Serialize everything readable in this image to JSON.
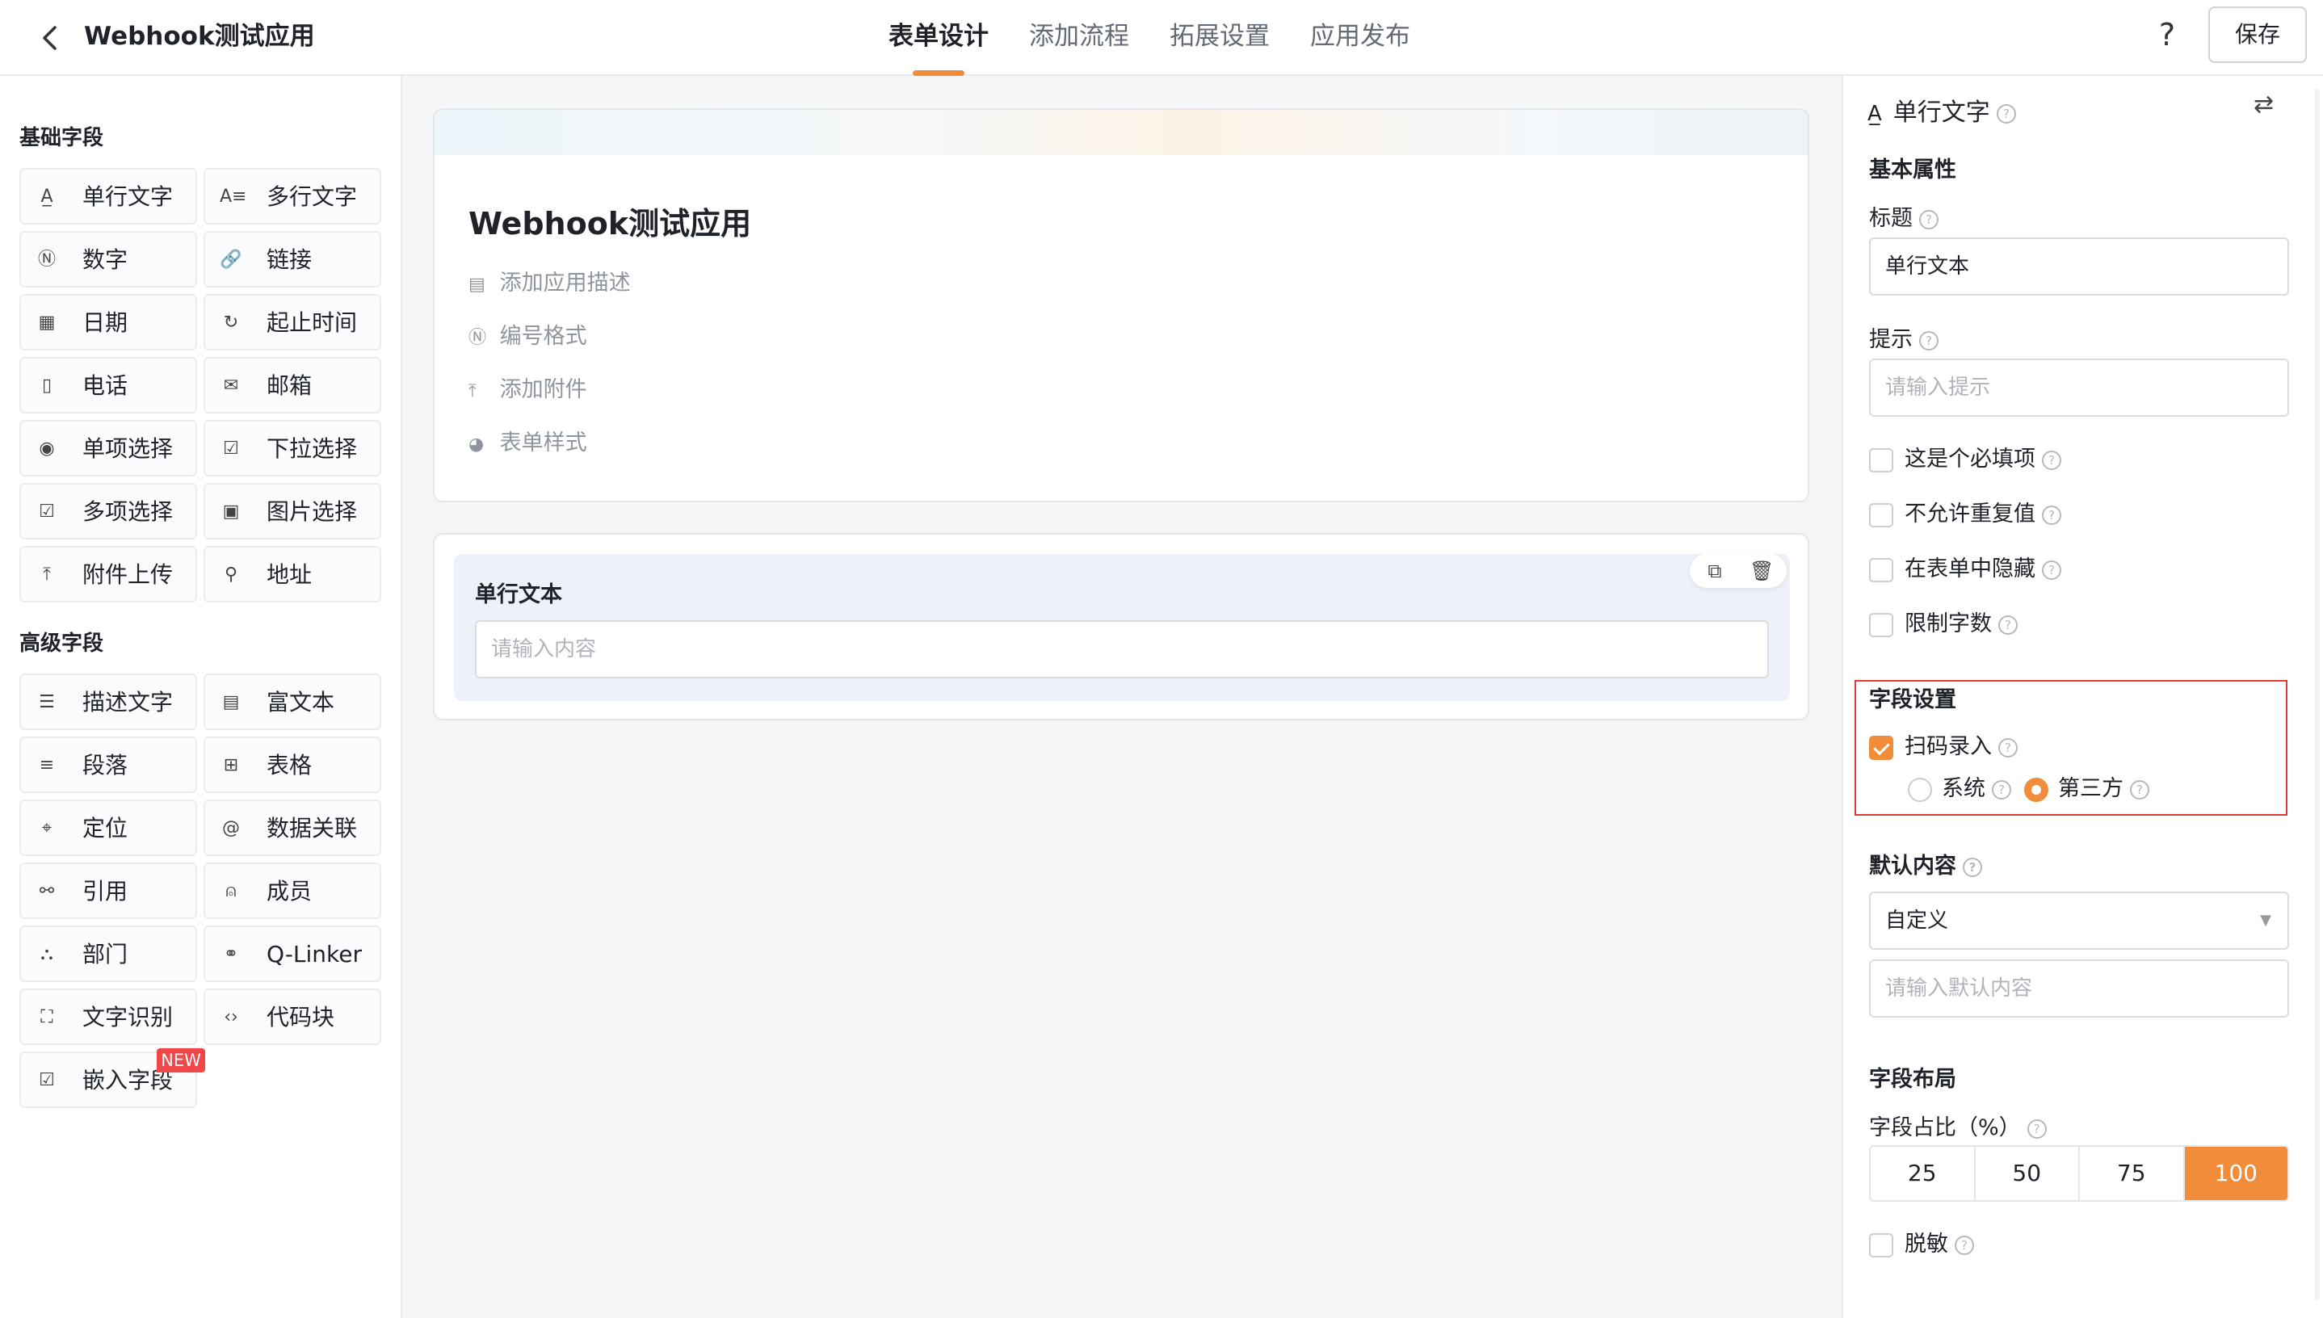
{
  "header": {
    "back_icon": "chevron-left-icon",
    "app_title": "Webhook测试应用",
    "tabs": [
      {
        "label": "表单设计",
        "active": true
      },
      {
        "label": "添加流程"
      },
      {
        "label": "拓展设置"
      },
      {
        "label": "应用发布"
      }
    ],
    "help_label": "?",
    "save_label": "保存",
    "accent_color": "#f08c3a"
  },
  "left": {
    "basic_title": "基础字段",
    "advanced_title": "高级字段",
    "basic_fields": [
      {
        "label": "单行文字",
        "icon": "A̲"
      },
      {
        "label": "多行文字",
        "icon": "A≡"
      },
      {
        "label": "数字",
        "icon": "Ⓝ"
      },
      {
        "label": "链接",
        "icon": "🔗"
      },
      {
        "label": "日期",
        "icon": "▦"
      },
      {
        "label": "起止时间",
        "icon": "↻"
      },
      {
        "label": "电话",
        "icon": "▯"
      },
      {
        "label": "邮箱",
        "icon": "✉"
      },
      {
        "label": "单项选择",
        "icon": "◉"
      },
      {
        "label": "下拉选择",
        "icon": "☑"
      },
      {
        "label": "多项选择",
        "icon": "☑"
      },
      {
        "label": "图片选择",
        "icon": "▣"
      },
      {
        "label": "附件上传",
        "icon": "⤒"
      },
      {
        "label": "地址",
        "icon": "⚲"
      }
    ],
    "advanced_fields": [
      {
        "label": "描述文字",
        "icon": "☰"
      },
      {
        "label": "富文本",
        "icon": "▤"
      },
      {
        "label": "段落",
        "icon": "≡"
      },
      {
        "label": "表格",
        "icon": "⊞"
      },
      {
        "label": "定位",
        "icon": "⌖"
      },
      {
        "label": "数据关联",
        "icon": "@"
      },
      {
        "label": "引用",
        "icon": "⚯"
      },
      {
        "label": "成员",
        "icon": "⍝"
      },
      {
        "label": "部门",
        "icon": "⛬"
      },
      {
        "label": "Q-Linker",
        "icon": "⚭"
      },
      {
        "label": "文字识别",
        "icon": "⛶"
      },
      {
        "label": "代码块",
        "icon": "‹›"
      },
      {
        "label": "嵌入字段",
        "icon": "☑"
      }
    ],
    "new_badge": "NEW"
  },
  "center": {
    "form_title": "Webhook测试应用",
    "meta": [
      {
        "label": "添加应用描述",
        "icon": "comment-icon"
      },
      {
        "label": "编号格式",
        "icon": "number-icon"
      },
      {
        "label": "添加附件",
        "icon": "upload-icon"
      },
      {
        "label": "表单样式",
        "icon": "palette-icon"
      }
    ],
    "field": {
      "label": "单行文本",
      "placeholder": "请输入内容"
    }
  },
  "right": {
    "panel_title": "单行文字",
    "basic_attrs": "基本属性",
    "title_label": "标题",
    "title_value": "单行文本",
    "hint_label": "提示",
    "hint_placeholder": "请输入提示",
    "checks": [
      {
        "label": "这是个必填项",
        "checked": false
      },
      {
        "label": "不允许重复值",
        "checked": false
      },
      {
        "label": "在表单中隐藏",
        "checked": false
      },
      {
        "label": "限制字数",
        "checked": false
      }
    ],
    "field_settings": "字段设置",
    "scan_label": "扫码录入",
    "scan_checked": true,
    "radio_system": "系统",
    "radio_third": "第三方",
    "default_content": "默认内容",
    "default_select": "自定义",
    "default_placeholder": "请输入默认内容",
    "layout_title": "字段布局",
    "ratio_label": "字段占比（%）",
    "ratios": [
      "25",
      "50",
      "75",
      "100"
    ],
    "ratio_selected": "100",
    "mask_label": "脱敏"
  }
}
